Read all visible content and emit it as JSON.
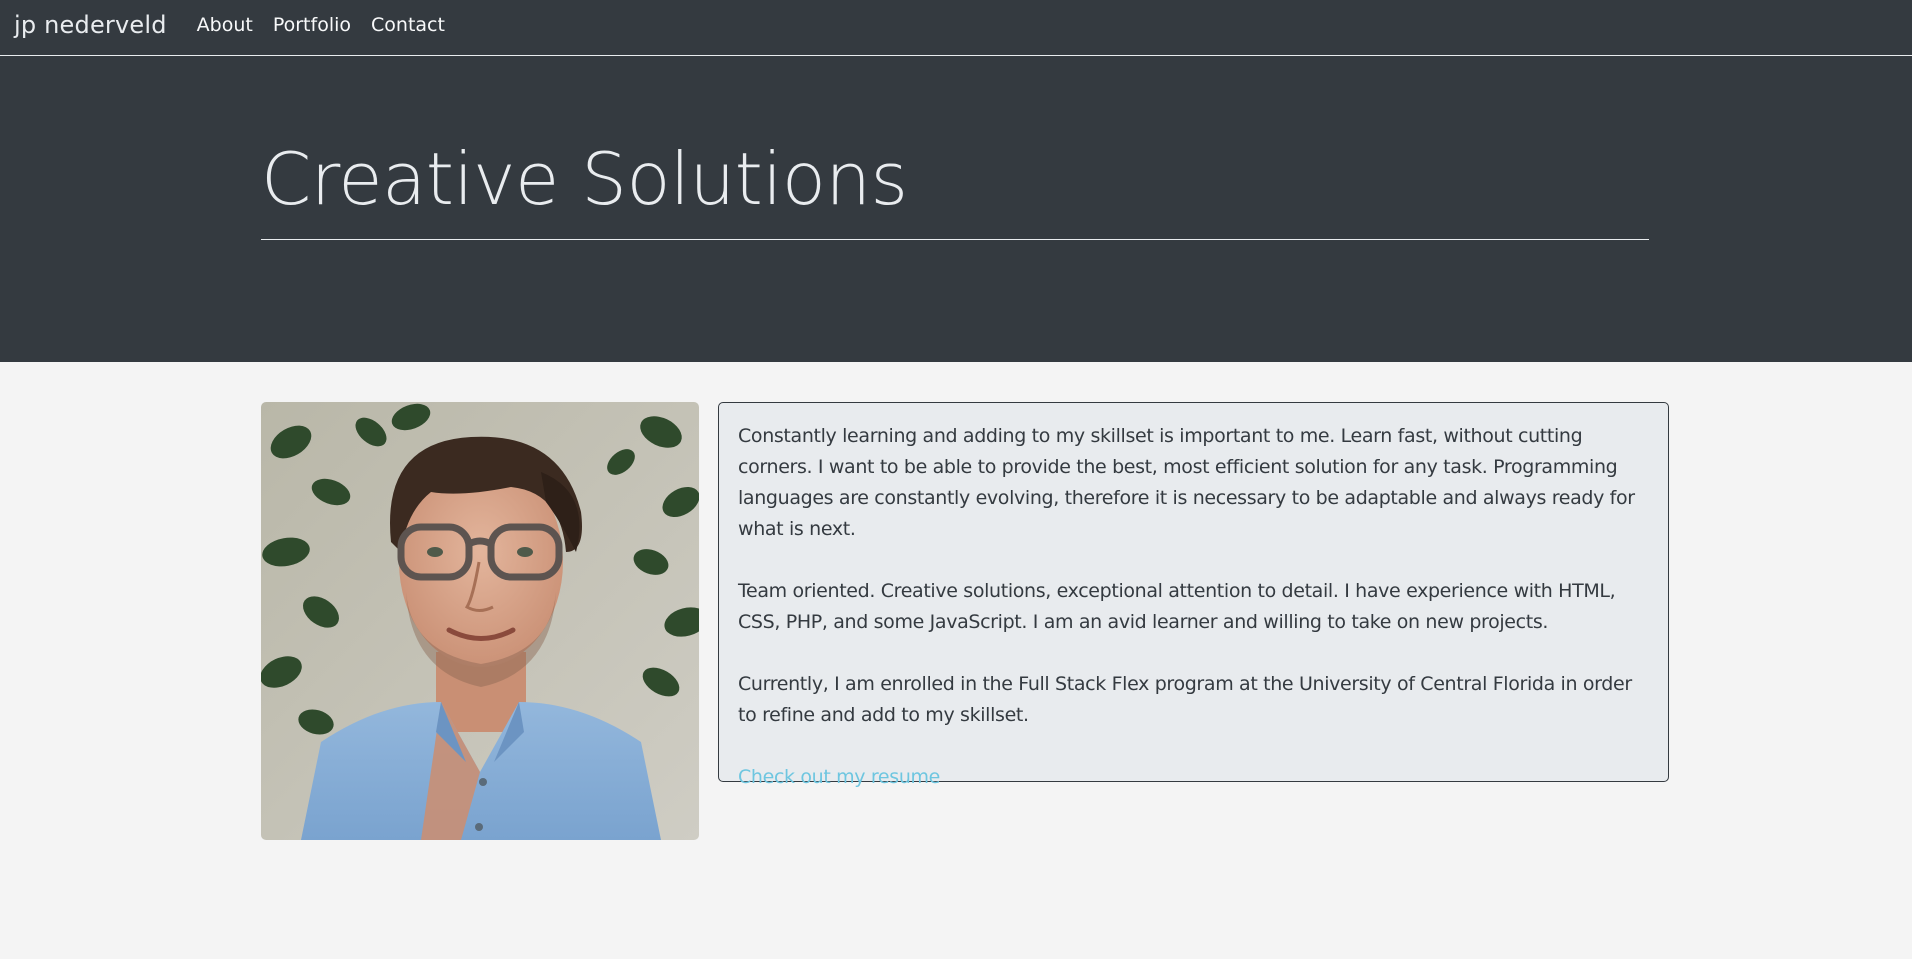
{
  "navbar": {
    "brand": "jp nederveld",
    "links": [
      "About",
      "Portfolio",
      "Contact"
    ]
  },
  "hero": {
    "title": "Creative Solutions"
  },
  "about": {
    "photo_icon": "portrait-photo",
    "paragraphs": [
      "Constantly learning and adding to my skillset is important to me. Learn fast, without cutting corners. I want to be able to provide the best, most efficient solution for any task. Programming languages are constantly evolving, therefore it is necessary to be adaptable and always ready for what is next.",
      "Team oriented. Creative solutions, exceptional attention to detail. I have experience with HTML, CSS, PHP, and some JavaScript. I am an avid learner and willing to take on new projects.",
      "Currently, I am enrolled in the Full Stack Flex program at the University of Central Florida in order to refine and add to my skillset."
    ],
    "resume_link": "Check out my resume"
  },
  "colors": {
    "dark": "#343a40",
    "light_text": "#e9ecef",
    "page_bg": "#f4f4f4",
    "card_bg": "#e8ebee",
    "link": "#6ec6e0"
  }
}
